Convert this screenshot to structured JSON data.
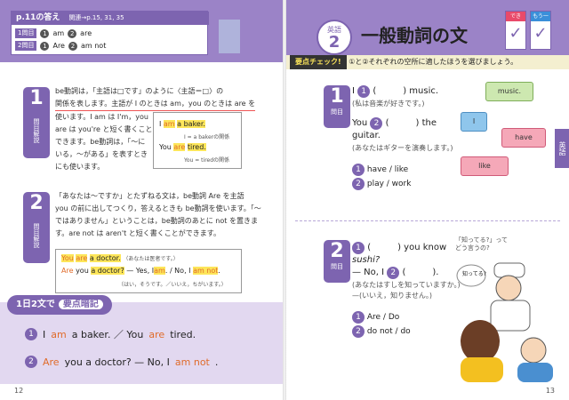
{
  "left": {
    "answer_box": {
      "title": "p.11の答え",
      "ref": "関連→p.15, 31, 35",
      "q1_tag": "1問目",
      "q1_a1_num": "1",
      "q1_a1": "am",
      "q1_a2_num": "2",
      "q1_a2": "are",
      "q2_tag": "2問目",
      "q2_a1_num": "1",
      "q2_a1": "Are",
      "q2_a2_num": "2",
      "q2_a2": "am not"
    },
    "q1": {
      "badge_num": "1",
      "badge_label": "問目解説",
      "lines": [
        "be動詞は，「主語は□です」のように〈主語＝□〉の",
        "関係を表します。主語が I のときは am，you のときは are を",
        "使います。I am は I'm，you",
        "are は you're と短く書くことも",
        "できます。be動詞は，「～に",
        "いる，～がある」を表すとき",
        "にも使います。"
      ],
      "example": {
        "row1_a": "I",
        "row1_b": "am",
        "row1_c": "a baker.",
        "row1_note": "I = a bakerの関係",
        "row2_a": "You",
        "row2_b": "are",
        "row2_c": "tired.",
        "row2_note": "You = tiredの関係"
      }
    },
    "q2": {
      "badge_num": "2",
      "badge_label": "問目解説",
      "lines": [
        "「あなたは～ですか」とたずねる文は，be動詞 Are を主語",
        "you の前に出してつくり，答えるときも be動詞を使います。「～",
        "ではありません」ということは，be動詞のあとに not を置きま",
        "す。are not は aren't と短く書くことができます。"
      ],
      "example": {
        "row1_a": "You",
        "row1_b": "are",
        "row1_c": "a doctor.",
        "row1_note": "（あなたは医者です。）",
        "row2_a": "Are",
        "row2_b": "you",
        "row2_c": "a doctor?",
        "row2_answer1": "— Yes, I",
        "row2_answer2": "am",
        "row2_answer3": ". / No, I",
        "row2_answer4": "am not",
        "row2_answer5": ".",
        "row3": "（はい，そうです。／いいえ，ちがいます。）"
      }
    },
    "memo": {
      "pill": "1日2文で",
      "pill_sub": "要点暗記",
      "s1_num": "1",
      "s1_a": "I",
      "s1_b": "am",
      "s1_c": "a baker. ／ You",
      "s1_d": "are",
      "s1_e": "tired.",
      "s2_num": "2",
      "s2_a": "Are",
      "s2_b": "you a doctor? — No, I",
      "s2_c": "am not",
      "s2_d": "."
    },
    "page_number": "12"
  },
  "right": {
    "subject_small": "英語",
    "lesson_num": "2",
    "title": "一般動詞の文",
    "check1": "できた！",
    "check2": "もう一度！",
    "check_mark": "✓",
    "point_tag": "要点チェック!",
    "point_text": "①と②それぞれの空所に適したほうを選びましょう。",
    "q1": {
      "badge_num": "1",
      "badge_label": "問目",
      "line1_a": "I",
      "line1_num": "1",
      "line1_b": "(　　　)  music.",
      "line1_jp": "(私は音楽が好きです。)",
      "line2_a": "You",
      "line2_num": "2",
      "line2_b": "(　　　)  the",
      "line3": "guitar.",
      "line3_jp": "(あなたはギターを演奏します。)",
      "opt1_num": "1",
      "opt1": "have / like",
      "opt2_num": "2",
      "opt2": "play / work",
      "pieces": [
        "music.",
        "I",
        "have",
        "like"
      ]
    },
    "q2": {
      "badge_num": "2",
      "badge_label": "問目",
      "line1_num": "1",
      "line1": "(　　　)  you know",
      "line2": "sushi?",
      "line3_a": "— No, I",
      "line3_num": "2",
      "line3_b": "(　　　).",
      "line4_jp": "(あなたはすしを知っていますか。)",
      "line5_jp": "—(いいえ，知りません。)",
      "opt1_num": "1",
      "opt1": "Are / Do",
      "opt2_num": "2",
      "opt2": "do not / do",
      "bubble1": "「知ってる?」って",
      "bubble2": "どう言うの?",
      "bubble3": "知ってる?"
    },
    "side_tab": "英語",
    "page_number": "13"
  }
}
